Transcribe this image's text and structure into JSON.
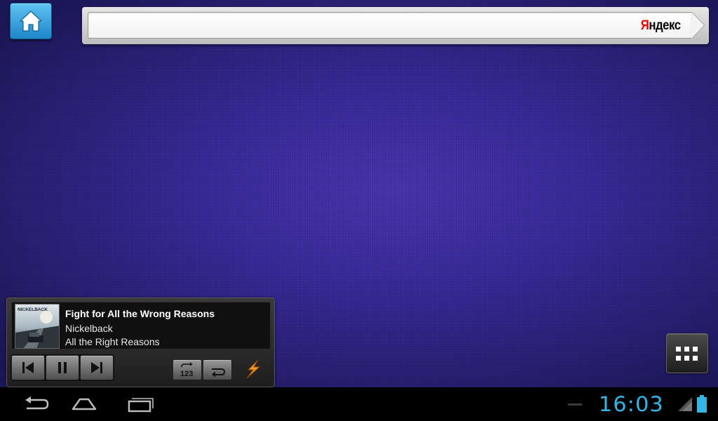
{
  "search": {
    "logo_first": "Я",
    "logo_rest": "ндекс",
    "placeholder": ""
  },
  "music": {
    "title": "Fight for All the Wrong Reasons",
    "artist": "Nickelback",
    "album": "All the Right Reasons",
    "album_art_text": "NICKELBACK",
    "shuffle_label": "123"
  },
  "status": {
    "time": "16:03"
  },
  "icons": {
    "home": "home-icon",
    "prev": "skip-previous-icon",
    "pause": "pause-icon",
    "next": "skip-next-icon",
    "shuffle": "shuffle-order-icon",
    "repeat": "repeat-icon",
    "app": "lightning-bolt-icon",
    "apps": "app-grid-icon",
    "back": "back-arrow-icon",
    "home_nav": "home-nav-icon",
    "recents": "recent-apps-icon",
    "signal": "signal-strength-icon",
    "battery": "battery-icon"
  },
  "colors": {
    "accent": "#33b5e5",
    "home_button": "#2a9ad8",
    "yandex_red": "#e60000"
  }
}
